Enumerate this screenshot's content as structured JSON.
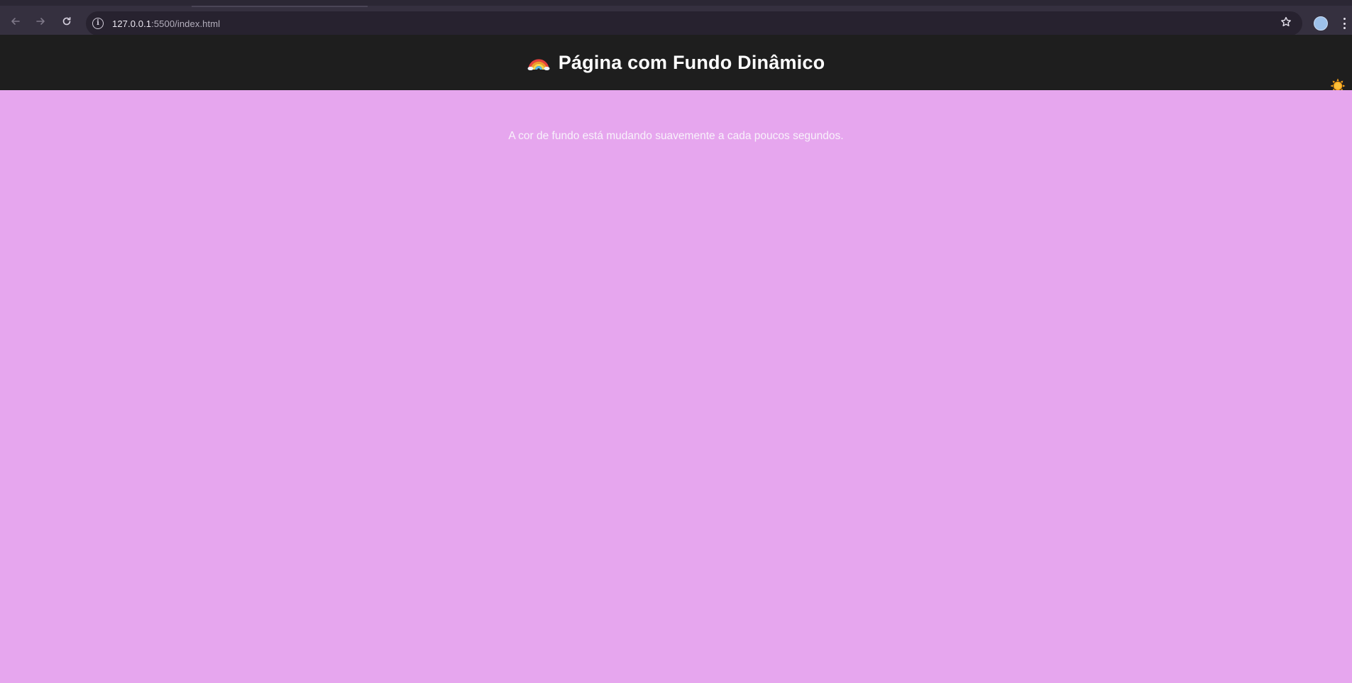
{
  "browser": {
    "url_host": "127.0.0.1",
    "url_rest": ":5500/index.html",
    "back_icon": "arrow-left-icon",
    "forward_icon": "arrow-right-icon",
    "reload_icon": "reload-icon",
    "info_icon": "info-icon",
    "bookmark_icon": "star-icon",
    "menu_icon": "kebab-menu-icon"
  },
  "page": {
    "title": "Página com Fundo Dinâmico",
    "title_icon": "rainbow-icon",
    "corner_icon": "sun-icon",
    "message": "A cor de fundo está mudando suavemente a cada poucos segundos.",
    "background_color": "#e6a6ee",
    "header_color": "#1e1e1e"
  }
}
